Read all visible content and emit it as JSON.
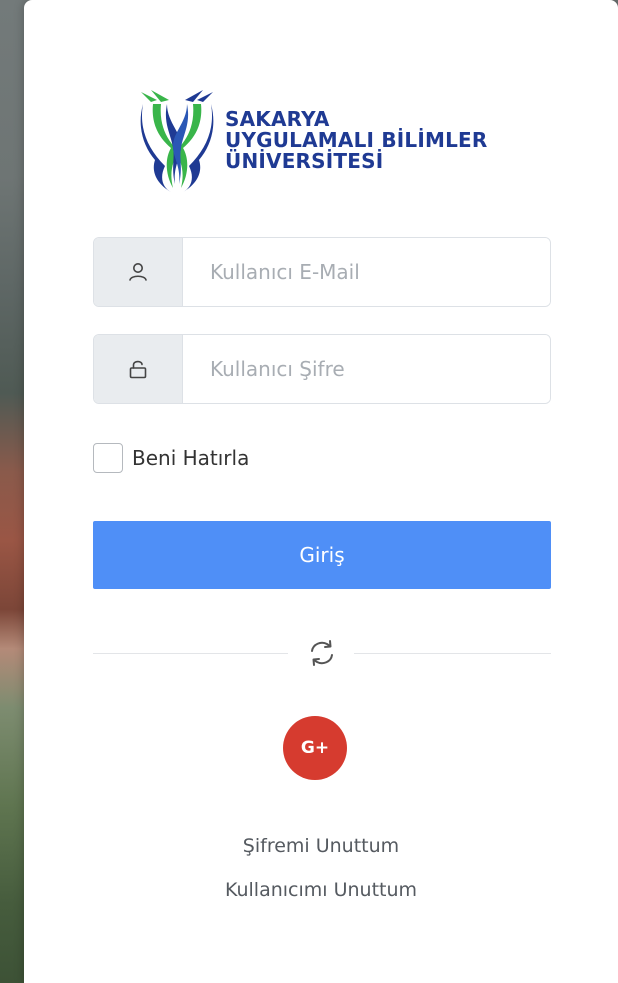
{
  "logo": {
    "line1": "SAKARYA",
    "line2": "UYGULAMALI BİLİMLER",
    "line3": "ÜNİVERSİTESİ"
  },
  "form": {
    "email_placeholder": "Kullanıcı E-Mail",
    "password_placeholder": "Kullanıcı Şifre",
    "remember_label": "Beni Hatırla",
    "login_label": "Giriş"
  },
  "social": {
    "google_label": "G+"
  },
  "links": {
    "forgot_password": "Şifremi Unuttum",
    "forgot_username": "Kullanıcımı Unuttum"
  },
  "colors": {
    "primary_button": "#4f8ff7",
    "google_button": "#d63b2f",
    "logo_blue": "#1f3a93",
    "logo_green": "#39b54a"
  }
}
